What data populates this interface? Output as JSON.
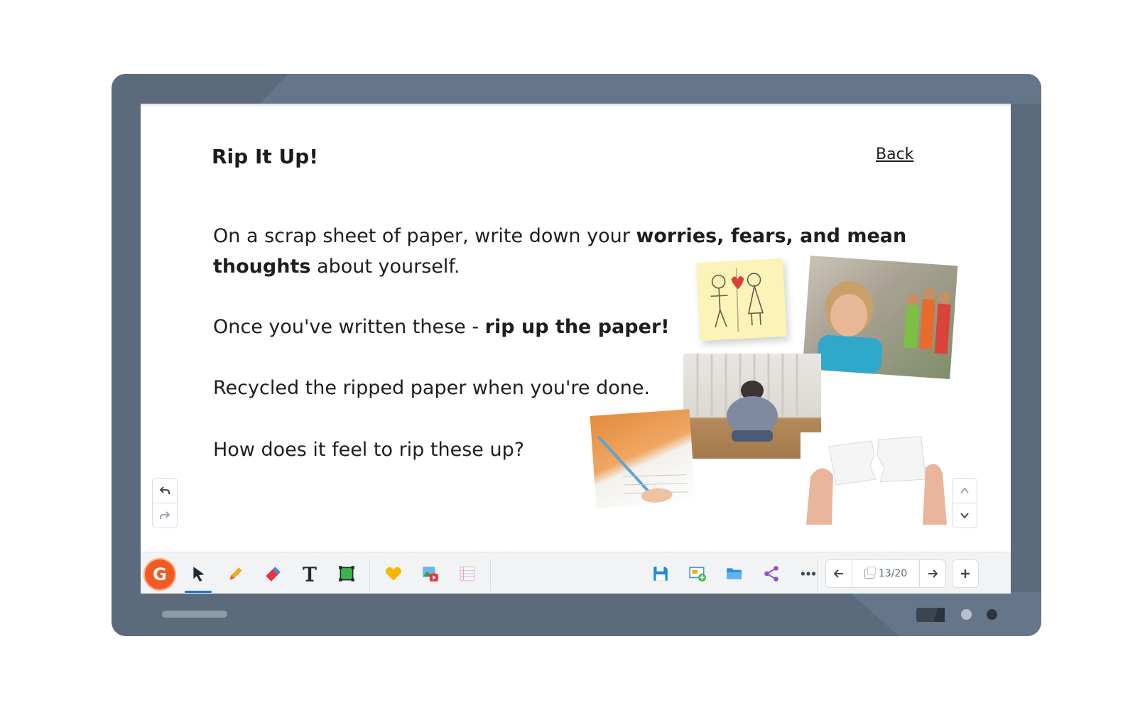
{
  "lesson": {
    "title": "Rip It Up!",
    "back_label": "Back"
  },
  "content": {
    "p1_a": "On a scrap sheet of paper, write down your ",
    "p1_bold": "worries, fears, and mean thoughts",
    "p1_b": " about yourself.",
    "p2_a": "Once you've written these - ",
    "p2_bold": "rip up the paper!",
    "p3": "Recycled the ripped paper when you're done.",
    "p4": "How does it feel to rip these up?"
  },
  "toolbar": {
    "app_logo_letter": "G",
    "page_indicator": "13/20",
    "icons": {
      "select": "cursor-arrow-icon",
      "pen": "pencil-icon",
      "eraser": "eraser-icon",
      "text": "text-icon",
      "shape": "shape-icon",
      "sticker": "heart-icon",
      "media": "media-icon",
      "template": "lined-paper-icon",
      "save": "save-icon",
      "add_screen": "add-screen-icon",
      "open": "folder-icon",
      "share": "share-icon",
      "more": "more-icon"
    }
  },
  "colors": {
    "frame": "#5c6b7b",
    "accent_orange": "#f15a22",
    "accent_blue": "#1c74c9"
  }
}
